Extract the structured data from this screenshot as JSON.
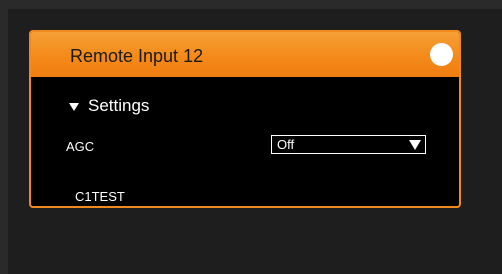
{
  "panel": {
    "title": "Remote Input 12",
    "accent_color": "#f48a1a",
    "status_indicator": "white-circle"
  },
  "settings": {
    "toggle_label": "Settings",
    "toggle_icon": "triangle-down-icon",
    "agc": {
      "label": "AGC",
      "value": "Off"
    }
  },
  "footer": {
    "channel_name": "C1TEST"
  }
}
